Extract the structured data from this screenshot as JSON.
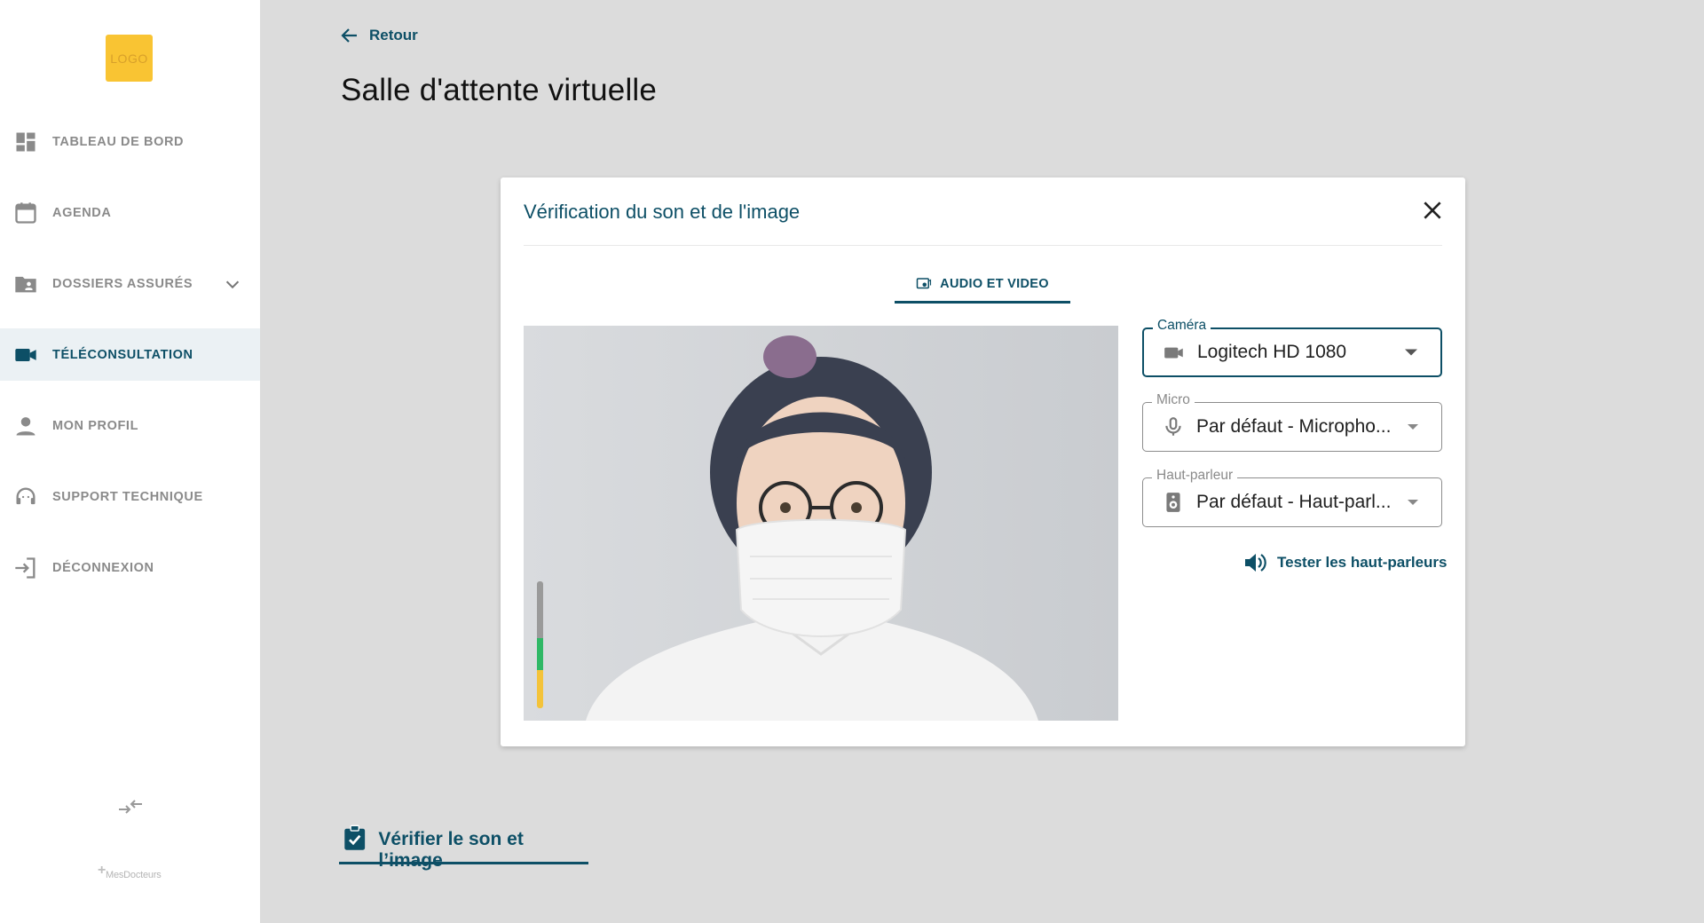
{
  "sidebar": {
    "logo_text": "LOGO",
    "items": [
      {
        "label": "TABLEAU DE BORD",
        "icon": "dashboard-icon",
        "active": false
      },
      {
        "label": "AGENDA",
        "icon": "calendar-icon",
        "active": false
      },
      {
        "label": "DOSSIERS ASSURÉS",
        "icon": "folder-user-icon",
        "active": false,
        "expandable": true
      },
      {
        "label": "TÉLÉCONSULTATION",
        "icon": "video-camera-icon",
        "active": true
      },
      {
        "label": "MON PROFIL",
        "icon": "person-icon",
        "active": false
      },
      {
        "label": "SUPPORT TECHNIQUE",
        "icon": "headset-icon",
        "active": false
      },
      {
        "label": "DÉCONNEXION",
        "icon": "logout-icon",
        "active": false
      }
    ],
    "brand_text": "MesDocteurs"
  },
  "header": {
    "back_label": "Retour",
    "title": "Salle d'attente virtuelle"
  },
  "modal": {
    "title": "Vérification du son et de l'image",
    "tab_label": "AUDIO ET VIDEO",
    "camera": {
      "label": "Caméra",
      "value": "Logitech HD 1080"
    },
    "micro": {
      "label": "Micro",
      "value": "Par défaut - Micropho..."
    },
    "speaker": {
      "label": "Haut-parleur",
      "value": "Par défaut - Haut-parl..."
    },
    "test_speakers_label": "Tester les haut-parleurs",
    "audio_level": 0.55
  },
  "footer": {
    "verify_label": "Vérifier le son et l’image"
  },
  "colors": {
    "primary": "#0d4f66",
    "active_bg": "#ebf1f4",
    "logo": "#f9c433",
    "meter_green": "#2fb866",
    "meter_yellow": "#f4c33a",
    "meter_grey": "#9a9a9a",
    "page_bg": "#dcdcdc"
  }
}
